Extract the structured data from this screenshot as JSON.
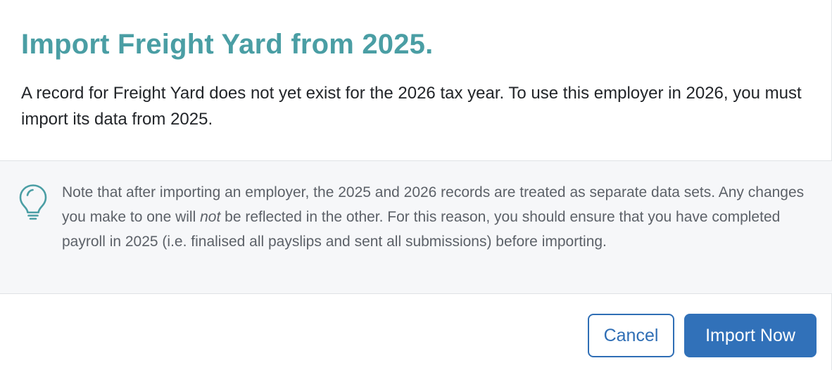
{
  "dialog": {
    "title": "Import Freight Yard from 2025.",
    "intro": "A record for Freight Yard does not yet exist for the 2026 tax year. To use this employer in 2026, you must import its data from 2025."
  },
  "note": {
    "icon": "lightbulb-icon",
    "text_before_emphasis": "Note that after importing an employer, the 2025 and 2026 records are treated as separate data sets. Any changes you make to one will ",
    "emphasis": "not",
    "text_after_emphasis": " be reflected in the other. For this reason, you should ensure that you have completed payroll in 2025 (i.e. finalised all payslips and sent all submissions) before importing."
  },
  "buttons": {
    "cancel_label": "Cancel",
    "import_label": "Import Now"
  },
  "colors": {
    "title": "#4a9ea4",
    "icon": "#4a9ea4",
    "primary": "#3171b9",
    "panel_bg": "#f6f7f9"
  }
}
